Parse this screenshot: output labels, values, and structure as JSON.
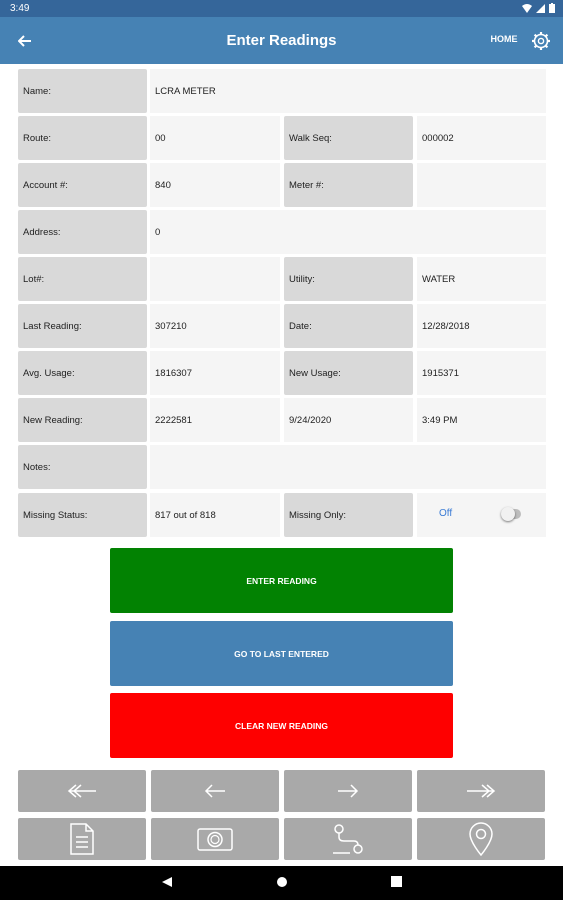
{
  "status": {
    "time": "3:49"
  },
  "header": {
    "title": "Enter Readings",
    "home_label": "HOME"
  },
  "form": {
    "name_label": "Name:",
    "name_value": "LCRA METER",
    "route_label": "Route:",
    "route_value": "00",
    "walk_seq_label": "Walk Seq:",
    "walk_seq_value": "000002",
    "account_label": "Account #:",
    "account_value": "840",
    "meter_label": "Meter #:",
    "meter_value": "",
    "address_label": "Address:",
    "address_value": "0",
    "lot_label": "Lot#:",
    "lot_value": "",
    "utility_label": "Utility:",
    "utility_value": "WATER",
    "last_reading_label": "Last Reading:",
    "last_reading_value": "307210",
    "date_label": "Date:",
    "date_value": "12/28/2018",
    "avg_usage_label": "Avg. Usage:",
    "avg_usage_value": "1816307",
    "new_usage_label": "New Usage:",
    "new_usage_value": "1915371",
    "new_reading_label": "New Reading:",
    "new_reading_value": "2222581",
    "new_reading_date": "9/24/2020",
    "new_reading_time": "3:49 PM",
    "notes_label": "Notes:",
    "notes_value": "",
    "missing_status_label": "Missing Status:",
    "missing_status_value": "817 out of 818",
    "missing_only_label": "Missing Only:",
    "missing_only_toggle": "Off"
  },
  "actions": {
    "enter_reading": "ENTER READING",
    "go_to_last": "GO TO LAST ENTERED",
    "clear_new": "CLEAR NEW READING"
  },
  "colors": {
    "status_bar": "#35669a",
    "app_bar": "#4682b4",
    "enter_button": "#028202",
    "last_button": "#4682b4",
    "clear_button": "#fe0000",
    "tool_button": "#a9a9a9"
  },
  "toolbar_icons": [
    "first-record-icon",
    "previous-record-icon",
    "next-record-icon",
    "last-record-icon",
    "document-icon",
    "camera-icon",
    "route-icon",
    "location-pin-icon"
  ]
}
